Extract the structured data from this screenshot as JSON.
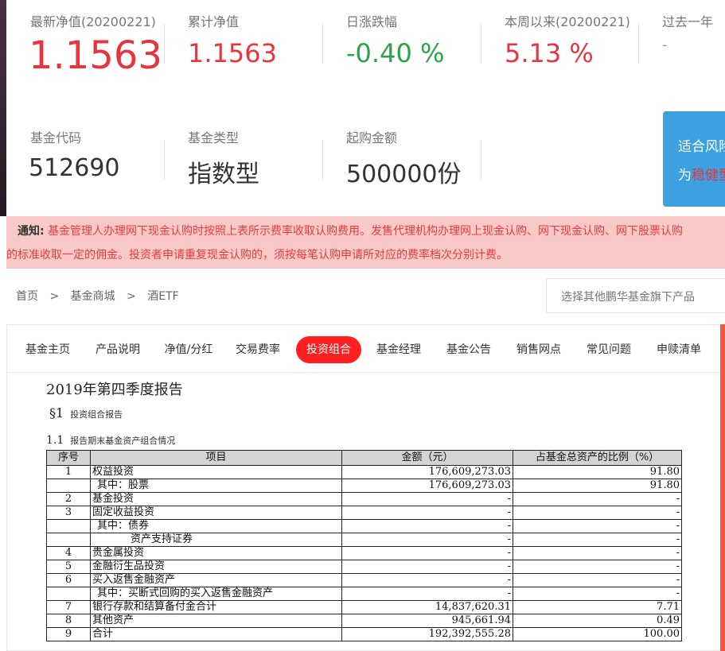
{
  "stats_row1": [
    {
      "label": "最新净值(20200221)",
      "value": "1.1563",
      "color": "#e8343c"
    },
    {
      "label": "累计净值",
      "value": "1.1563",
      "color": "#e8343c"
    },
    {
      "label": "日涨跌幅",
      "value": "-0.40 %",
      "color": "#2aa44a"
    },
    {
      "label": "本周以来(20200221)",
      "value": "5.13 %",
      "color": "#e8343c"
    },
    {
      "label": "过去一年",
      "value": "-",
      "color": "#999999"
    }
  ],
  "stats_row2": [
    {
      "label": "基金代码",
      "value": "512690"
    },
    {
      "label": "基金类型",
      "value": "指数型"
    },
    {
      "label": "起购金额",
      "value": "500000份"
    }
  ],
  "risk_box": {
    "line1": "适合风险",
    "line2_prefix": "为",
    "line2_highlight": "稳健型"
  },
  "notice": {
    "label": "通知:",
    "line1": "基金管理人办理网下现金认购时按照上表所示费率收取认购费用。发售代理机构办理网上现金认购、网下现金认购、网下股票认购",
    "line2": "的标准收取一定的佣金。投资者申请重复现金认购的，须按每笔认购申请所对应的费率档次分别计费。"
  },
  "breadcrumb": {
    "home": "首页",
    "sep": ">",
    "mall": "基金商城",
    "current": "酒ETF"
  },
  "fund_select": {
    "placeholder": "选择其他鹏华基金旗下产品"
  },
  "tabs": [
    "基金主页",
    "产品说明",
    "净值/分红",
    "交易费率",
    "投资组合",
    "基金经理",
    "基金公告",
    "销售网点",
    "常见问题",
    "申赎清单"
  ],
  "report": {
    "title": "2019年第四季度报告",
    "sec1_num": "§1",
    "sec1_label": "投资组合报告",
    "sec11_num": "1.1",
    "sec11_label": "报告期末基金资产组合情况",
    "table": {
      "headers": [
        "序号",
        "项目",
        "金额（元）",
        "占基金总资产的比例（%）"
      ],
      "rows": [
        [
          "1",
          "权益投资",
          "176,609,273.03",
          "91.80"
        ],
        [
          "",
          "其中：股票",
          "176,609,273.03",
          "91.80"
        ],
        [
          "2",
          "基金投资",
          "-",
          "-"
        ],
        [
          "3",
          "固定收益投资",
          "-",
          "-"
        ],
        [
          "",
          "其中：债券",
          "-",
          "-"
        ],
        [
          "",
          "资产支持证券",
          "-",
          "-"
        ],
        [
          "4",
          "贵金属投资",
          "-",
          "-"
        ],
        [
          "5",
          "金融衍生品投资",
          "-",
          "-"
        ],
        [
          "6",
          "买入返售金融资产",
          "-",
          "-"
        ],
        [
          "",
          "其中：买断式回购的买入返售金融资产",
          "-",
          "-"
        ],
        [
          "7",
          "银行存款和结算备付金合计",
          "14,837,620.31",
          "7.71"
        ],
        [
          "8",
          "其他资产",
          "945,661.94",
          "0.49"
        ],
        [
          "9",
          "合计",
          "192,392,555.28",
          "100.00"
        ]
      ]
    }
  }
}
